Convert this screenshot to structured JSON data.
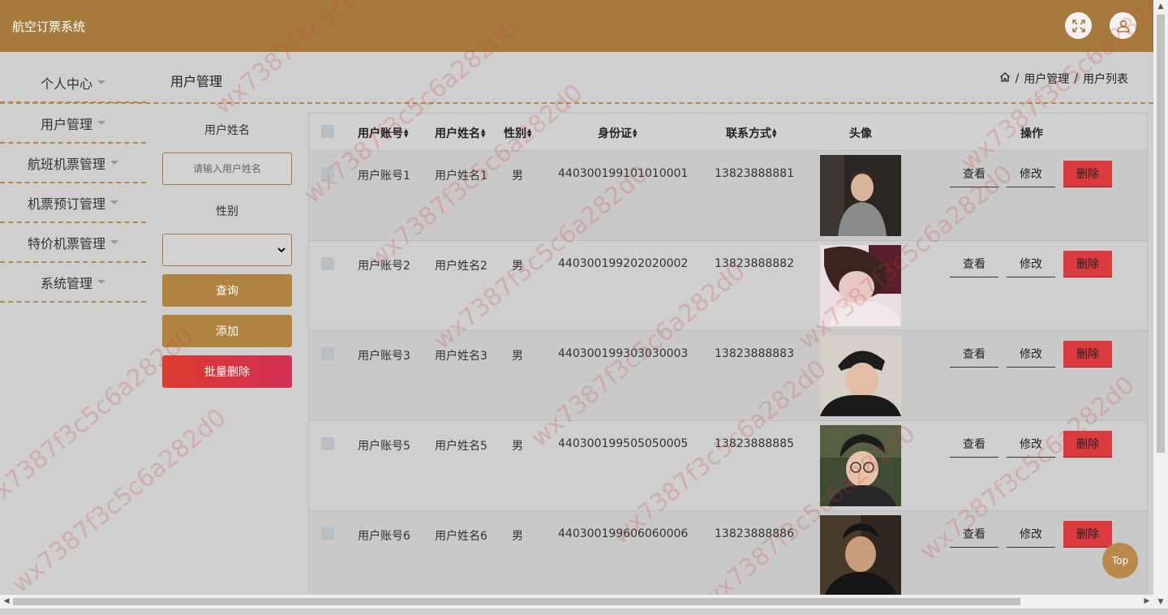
{
  "header": {
    "app_title": "航空订票系统",
    "fullscreen_icon": "expand-icon",
    "user_icon": "user-icon"
  },
  "sidebar": {
    "items": [
      {
        "label": "个人中心"
      },
      {
        "label": "用户管理"
      },
      {
        "label": "航班机票管理"
      },
      {
        "label": "机票预订管理"
      },
      {
        "label": "特价机票管理"
      },
      {
        "label": "系统管理"
      }
    ]
  },
  "page": {
    "title": "用户管理",
    "breadcrumb": [
      "用户管理",
      "用户列表"
    ],
    "breadcrumb_sep": "/"
  },
  "search": {
    "name_label": "用户姓名",
    "name_placeholder": "请输入用户姓名",
    "gender_label": "性别",
    "gender_value": "",
    "query_label": "查询",
    "add_label": "添加",
    "batch_delete_label": "批量删除"
  },
  "table": {
    "columns": [
      "用户账号",
      "用户姓名",
      "性别",
      "身份证",
      "联系方式",
      "头像",
      "操作"
    ],
    "row_buttons": {
      "view": "查看",
      "edit": "修改",
      "delete": "删除"
    },
    "rows": [
      {
        "account": "用户账号1",
        "name": "用户姓名1",
        "gender": "男",
        "id_card": "440300199101010001",
        "phone": "13823888881"
      },
      {
        "account": "用户账号2",
        "name": "用户姓名2",
        "gender": "男",
        "id_card": "440300199202020002",
        "phone": "13823888882"
      },
      {
        "account": "用户账号3",
        "name": "用户姓名3",
        "gender": "男",
        "id_card": "440300199303030003",
        "phone": "13823888883"
      },
      {
        "account": "用户账号5",
        "name": "用户姓名5",
        "gender": "男",
        "id_card": "440300199505050005",
        "phone": "13823888885"
      },
      {
        "account": "用户账号6",
        "name": "用户姓名6",
        "gender": "男",
        "id_card": "440300199606060006",
        "phone": "13823888886"
      }
    ]
  },
  "top_button": "Top",
  "watermark": "wx7387f3c5c6a282d0",
  "colors": {
    "brand": "#a67a3d",
    "button": "#b08440",
    "danger": "#db3a3e",
    "danger_gradient_end": "#d13056"
  }
}
